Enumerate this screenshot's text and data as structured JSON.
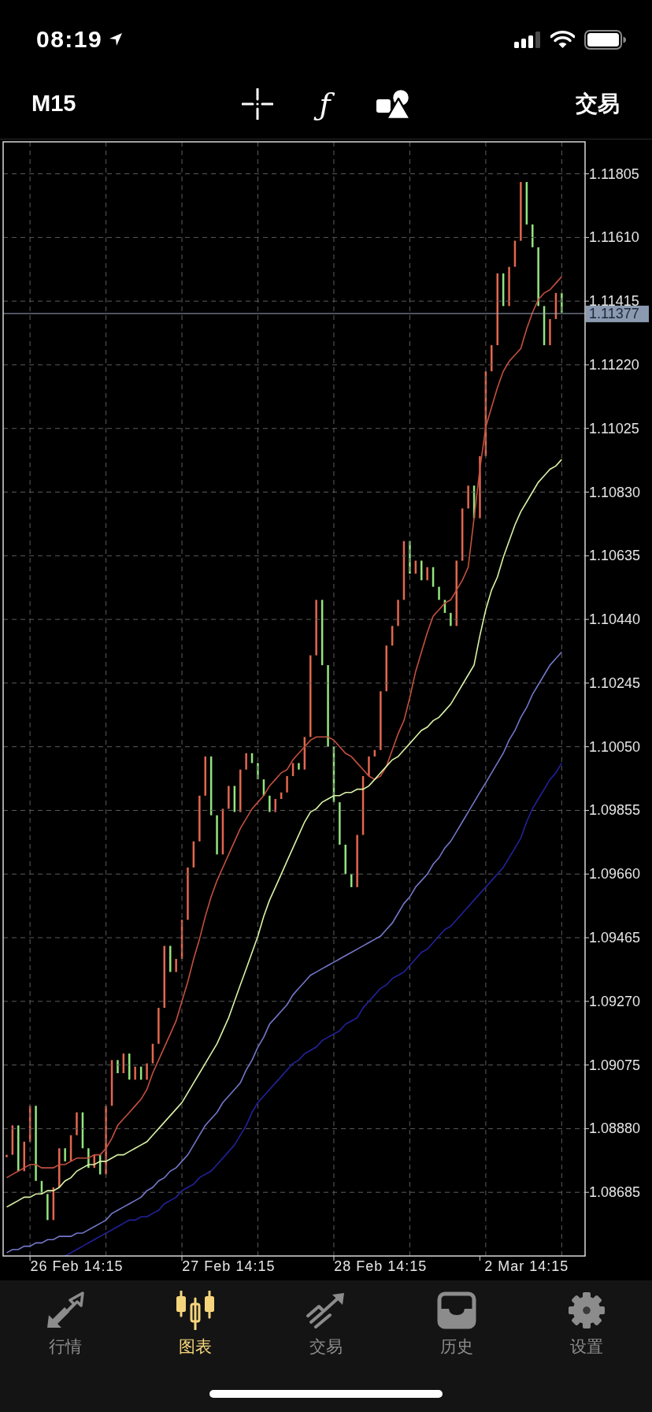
{
  "status_bar": {
    "time": "08:19"
  },
  "toolbar": {
    "timeframe": "M15",
    "indicators_button": "ƒ",
    "trade_button": "交易"
  },
  "chart": {
    "chart_data": {
      "type": "line",
      "grid": true,
      "categories": [
        null,
        null,
        null,
        null,
        null,
        null,
        null,
        null,
        null,
        null,
        null,
        null,
        "26 Feb 14:15",
        null,
        null,
        null,
        null,
        null,
        null,
        null,
        null,
        null,
        null,
        null,
        null,
        null,
        null,
        null,
        null,
        null,
        null,
        null,
        null,
        null,
        null,
        null,
        null,
        null,
        "27 Feb 14:15",
        null,
        null,
        null,
        null,
        null,
        null,
        null,
        null,
        null,
        null,
        null,
        null,
        null,
        null,
        null,
        null,
        null,
        null,
        null,
        null,
        null,
        null,
        null,
        null,
        null,
        "28 Feb 14:15",
        null,
        null,
        null,
        null,
        null,
        null,
        null,
        null,
        null,
        null,
        null,
        null,
        null,
        null,
        null,
        null,
        null,
        null,
        null,
        null,
        null,
        null,
        null,
        null,
        "2 Mar 14:15",
        null,
        null,
        null,
        null,
        null,
        null
      ],
      "ylim": [
        1.0849,
        1.11903
      ],
      "yticks": [
        {
          "value": 1.11805,
          "label": "1.11805"
        },
        {
          "value": 1.1161,
          "label": "1.11610"
        },
        {
          "value": 1.11415,
          "label": "1.11415"
        },
        {
          "value": 1.1122,
          "label": "1.11220"
        },
        {
          "value": 1.11025,
          "label": "1.11025"
        },
        {
          "value": 1.1083,
          "label": "1.10830"
        },
        {
          "value": 1.10635,
          "label": "1.10635"
        },
        {
          "value": 1.1044,
          "label": "1.10440"
        },
        {
          "value": 1.10245,
          "label": "1.10245"
        },
        {
          "value": 1.1005,
          "label": "1.10050"
        },
        {
          "value": 1.09855,
          "label": "1.09855"
        },
        {
          "value": 1.0966,
          "label": "1.09660"
        },
        {
          "value": 1.09465,
          "label": "1.09465"
        },
        {
          "value": 1.0927,
          "label": "1.09270"
        },
        {
          "value": 1.09075,
          "label": "1.09075"
        },
        {
          "value": 1.0888,
          "label": "1.08880"
        },
        {
          "value": 1.08685,
          "label": "1.08685"
        }
      ],
      "series": [
        {
          "color": "#c4503f",
          "values": [
            1.0873,
            1.0874,
            1.0875,
            1.0876,
            1.0877,
            1.0877,
            1.0876,
            1.0876,
            1.0876,
            1.0877,
            1.0877,
            1.0878,
            1.0879,
            1.0879,
            1.0879,
            1.088,
            1.088,
            1.0882,
            1.0885,
            1.0889,
            1.0891,
            1.0893,
            1.0895,
            1.0897,
            1.09,
            1.0905,
            1.0909,
            1.0913,
            1.0917,
            1.0921,
            1.0927,
            1.0933,
            1.094,
            1.0946,
            1.0953,
            1.0959,
            1.0964,
            1.0968,
            1.0972,
            1.0976,
            1.098,
            1.0983,
            1.0986,
            1.0988,
            1.099,
            1.0993,
            1.0995,
            1.0997,
            1.0998,
            1.1001,
            1.1003,
            1.1005,
            1.1007,
            1.1008,
            1.1008,
            1.1008,
            1.1007,
            1.1005,
            1.1003,
            1.1002,
            1.1,
            1.0998,
            1.0996,
            1.0995,
            1.0996,
            1.0999,
            1.1004,
            1.1009,
            1.1013,
            1.102,
            1.1028,
            1.1034,
            1.104,
            1.1045,
            1.1047,
            1.1049,
            1.105,
            1.1053,
            1.1056,
            1.106,
            1.1075,
            1.109,
            1.1103,
            1.1109,
            1.1115,
            1.112,
            1.1123,
            1.1125,
            1.1127,
            1.1133,
            1.1138,
            1.1142,
            1.1144,
            1.1145,
            1.1147,
            1.1149
          ]
        },
        {
          "color": "#d9f2a6",
          "values": [
            1.0864,
            1.0865,
            1.0866,
            1.0867,
            1.0867,
            1.0868,
            1.0868,
            1.0869,
            1.0869,
            1.087,
            1.0872,
            1.0873,
            1.0875,
            1.0876,
            1.0877,
            1.0877,
            1.0878,
            1.0878,
            1.0879,
            1.088,
            1.088,
            1.0881,
            1.0882,
            1.0883,
            1.0884,
            1.0886,
            1.0888,
            1.089,
            1.0892,
            1.0894,
            1.0896,
            1.0899,
            1.0902,
            1.0905,
            1.0908,
            1.0911,
            1.0914,
            1.0918,
            1.0922,
            1.0927,
            1.0932,
            1.0937,
            1.0942,
            1.0947,
            1.0953,
            1.0958,
            1.0962,
            1.0966,
            1.097,
            1.0974,
            1.0978,
            1.0982,
            1.0985,
            1.0986,
            1.0988,
            1.0989,
            1.099,
            1.099,
            1.0991,
            1.0991,
            1.0992,
            1.0992,
            1.0993,
            1.0995,
            1.0997,
            1.0999,
            1.1001,
            1.1002,
            1.1004,
            1.1006,
            1.1008,
            1.101,
            1.1011,
            1.1013,
            1.1014,
            1.1016,
            1.1018,
            1.1021,
            1.1024,
            1.1027,
            1.103,
            1.1039,
            1.1047,
            1.1053,
            1.1057,
            1.1063,
            1.1068,
            1.1073,
            1.1077,
            1.108,
            1.1083,
            1.1086,
            1.1088,
            1.109,
            1.1091,
            1.1093
          ]
        },
        {
          "color": "#7377c9",
          "values": [
            1.085,
            1.0851,
            1.0851,
            1.0852,
            1.0852,
            1.0853,
            1.0853,
            1.0854,
            1.0854,
            1.0855,
            1.0855,
            1.0855,
            1.0856,
            1.0856,
            1.0857,
            1.0858,
            1.0859,
            1.086,
            1.0862,
            1.0863,
            1.0864,
            1.0865,
            1.0866,
            1.0867,
            1.0869,
            1.087,
            1.0872,
            1.0873,
            1.0875,
            1.0876,
            1.0878,
            1.088,
            1.0883,
            1.0886,
            1.0889,
            1.0891,
            1.0893,
            1.0896,
            1.0898,
            1.09,
            1.0902,
            1.0906,
            1.0909,
            1.0913,
            1.0916,
            1.092,
            1.0922,
            1.0924,
            1.0926,
            1.0929,
            1.0931,
            1.0933,
            1.0935,
            1.0936,
            1.0937,
            1.0938,
            1.0939,
            1.094,
            1.0941,
            1.0942,
            1.0943,
            1.0944,
            1.0945,
            1.0946,
            1.0947,
            1.0949,
            1.0951,
            1.0954,
            1.0957,
            1.0959,
            1.0962,
            1.0964,
            1.0966,
            1.0969,
            1.0971,
            1.0974,
            1.0976,
            1.0979,
            1.0982,
            1.0985,
            1.0988,
            1.0991,
            1.0994,
            1.0997,
            1.1,
            1.1003,
            1.1007,
            1.101,
            1.1014,
            1.1017,
            1.1021,
            1.1024,
            1.1027,
            1.103,
            1.1032,
            1.1034
          ]
        },
        {
          "color": "#22229c",
          "values": [
            null,
            null,
            null,
            null,
            null,
            null,
            null,
            null,
            null,
            null,
            1.0849,
            1.085,
            1.0851,
            1.0852,
            1.0853,
            1.0854,
            1.0855,
            1.0856,
            1.0857,
            1.0858,
            1.0859,
            1.086,
            1.086,
            1.0861,
            1.0861,
            1.0862,
            1.0863,
            1.0865,
            1.0866,
            1.0867,
            1.0869,
            1.087,
            1.0871,
            1.0873,
            1.0874,
            1.0875,
            1.0877,
            1.0879,
            1.0881,
            1.0883,
            1.0886,
            1.0889,
            1.0893,
            1.0896,
            1.0898,
            1.09,
            1.0902,
            1.0904,
            1.0906,
            1.0908,
            1.0909,
            1.0911,
            1.0912,
            1.0913,
            1.0915,
            1.0916,
            1.0917,
            1.0918,
            1.092,
            1.0921,
            1.0922,
            1.0925,
            1.0927,
            1.0929,
            1.0931,
            1.0932,
            1.0934,
            1.0935,
            1.0936,
            1.0938,
            1.094,
            1.0942,
            1.0943,
            1.0945,
            1.0947,
            1.0949,
            1.095,
            1.0952,
            1.0954,
            1.0956,
            1.0958,
            1.096,
            1.0962,
            1.0964,
            1.0966,
            1.0968,
            1.0971,
            1.0974,
            1.0977,
            1.0982,
            1.0986,
            1.0989,
            1.0992,
            1.0995,
            1.0997,
            1.1
          ]
        }
      ],
      "ref_lines": [
        {
          "axis": "y",
          "value": 1.11377,
          "label": "1.11377"
        }
      ]
    }
  },
  "tab_bar": {
    "tabs": [
      {
        "label": "行情",
        "selected": false
      },
      {
        "label": "图表",
        "selected": true
      },
      {
        "label": "交易",
        "selected": false
      },
      {
        "label": "历史",
        "selected": false
      },
      {
        "label": "设置",
        "selected": false
      }
    ]
  }
}
